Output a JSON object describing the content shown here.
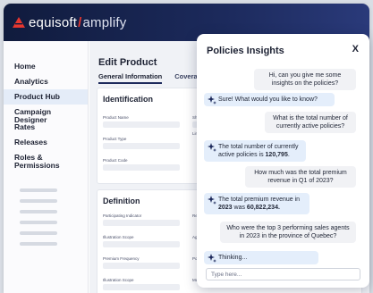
{
  "brand": {
    "logo_main": "equisoft",
    "logo_sep": "/",
    "logo_sub": "amplify",
    "accent": "#e6372f",
    "navy": "#101b3d"
  },
  "sidebar": {
    "items": [
      {
        "label": "Home"
      },
      {
        "label": "Analytics"
      },
      {
        "label": "Product Hub",
        "active": true
      },
      {
        "label": "Campaign Designer"
      },
      {
        "label": "Rates"
      },
      {
        "label": "Releases"
      },
      {
        "label": "Roles & Permissions"
      }
    ]
  },
  "main": {
    "title": "Edit Product",
    "tabs": [
      {
        "label": "General Information",
        "active": true
      },
      {
        "label": "Coverage"
      }
    ],
    "identification": {
      "title": "Identification",
      "fields": [
        "Product Name",
        "Product Type",
        "Product Code"
      ],
      "right_fields": [
        "Shorte",
        "Line o"
      ]
    },
    "definition": {
      "title": "Definition",
      "fields": [
        "Participating Indicator",
        "Illustration Scope",
        "Premium Frequency",
        "Illustration Scope"
      ],
      "right_fields": [
        "Registe",
        "Age C",
        "Policy",
        "Maxim"
      ]
    }
  },
  "insights": {
    "title": "Policies Insights",
    "close_label": "X",
    "messages": [
      {
        "role": "user",
        "text": "Hi, can you give me some insights on the policies?"
      },
      {
        "role": "bot",
        "text": "Sure! What would you like to know?"
      },
      {
        "role": "user",
        "text": "What is the total number of currently active policies?"
      },
      {
        "role": "bot",
        "prefix": "The total number of currently active policies is ",
        "bold": "120,795",
        "suffix": "."
      },
      {
        "role": "user",
        "text": "How much was the total premium revenue in Q1 of 2023?"
      },
      {
        "role": "bot",
        "prefix": "The total premium revenue in ",
        "bold": "2023",
        "suffix": " was ",
        "bold2": "60,822,234."
      },
      {
        "role": "user",
        "text": "Who were the top 3 performing sales agents in 2023 in the province of Quebec?"
      },
      {
        "role": "bot",
        "text": "Thinking..."
      }
    ],
    "input_placeholder": "Type here...",
    "icon": "sparkle-icon"
  }
}
